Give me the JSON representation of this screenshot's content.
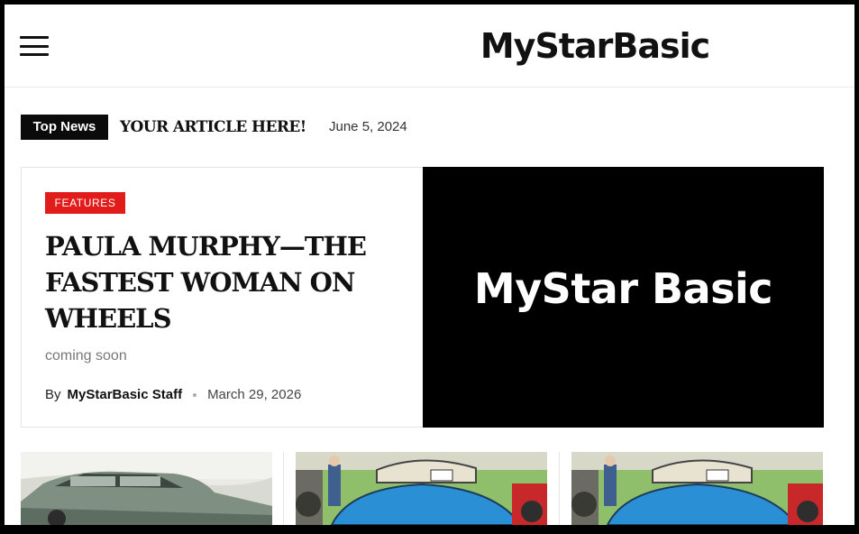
{
  "header": {
    "menu_icon": "hamburger-menu-icon",
    "site_title": "MyStarBasic"
  },
  "ticker": {
    "label": "Top News",
    "headline": "YOUR ARTICLE HERE!",
    "date": "June 5, 2024"
  },
  "feature": {
    "category": "FEATURES",
    "title": "PAULA MURPHY—THE FASTEST WOMAN ON WHEELS",
    "excerpt": "coming soon",
    "by_label": "By",
    "author": "MyStarBasic Staff",
    "date": "March 29, 2026",
    "image_text": "MyStar Basic"
  },
  "colors": {
    "accent_red": "#e21b1b",
    "badge_black": "#0b0b0b",
    "text_dark": "#111111"
  }
}
